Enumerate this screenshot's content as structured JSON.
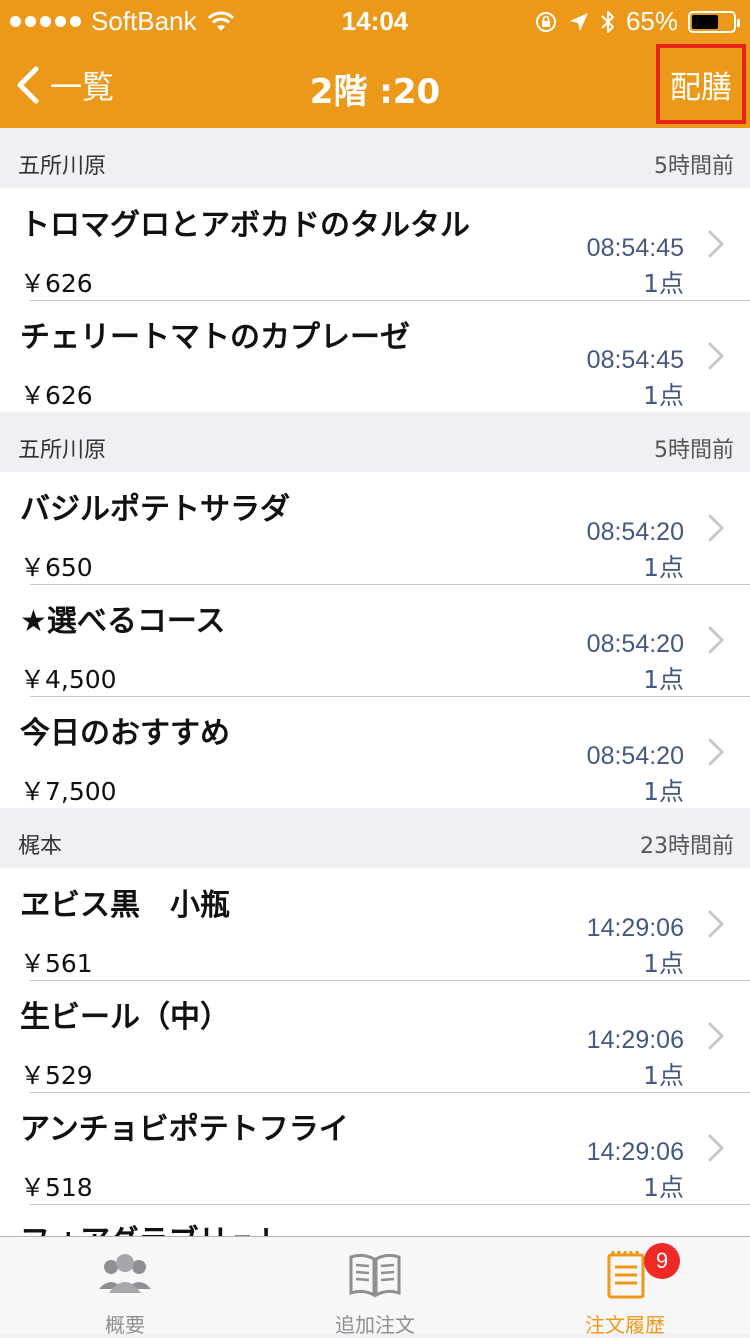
{
  "status_bar": {
    "carrier": "SoftBank",
    "time": "14:04",
    "battery_percent": "65%",
    "battery_level": 0.65
  },
  "nav": {
    "back_label": "一覧",
    "title": "2階 :20",
    "action_label": "配膳"
  },
  "sections": [
    {
      "name": "五所川原",
      "ago": "5時間前",
      "rows": [
        {
          "item": "トロマグロとアボカドのタルタル",
          "price": "￥626",
          "time": "08:54:45",
          "qty": "1点"
        },
        {
          "item": "チェリートマトのカプレーゼ",
          "price": "￥626",
          "time": "08:54:45",
          "qty": "1点"
        }
      ]
    },
    {
      "name": "五所川原",
      "ago": "5時間前",
      "rows": [
        {
          "item": "バジルポテトサラダ",
          "price": "￥650",
          "time": "08:54:20",
          "qty": "1点"
        },
        {
          "item": "★選べるコース",
          "price": "￥4,500",
          "time": "08:54:20",
          "qty": "1点"
        },
        {
          "item": "今日のおすすめ",
          "price": "￥7,500",
          "time": "08:54:20",
          "qty": "1点"
        }
      ]
    },
    {
      "name": "梶本",
      "ago": "23時間前",
      "rows": [
        {
          "item": "ヱビス黒　小瓶",
          "price": "￥561",
          "time": "14:29:06",
          "qty": "1点"
        },
        {
          "item": "生ビール（中）",
          "price": "￥529",
          "time": "14:29:06",
          "qty": "1点"
        },
        {
          "item": "アンチョビポテトフライ",
          "price": "￥518",
          "time": "14:29:06",
          "qty": "1点"
        },
        {
          "item": "フォアグラブリュレ",
          "price": "",
          "time": "",
          "qty": ""
        }
      ]
    }
  ],
  "tabs": [
    {
      "label": "概要",
      "icon": "people-icon"
    },
    {
      "label": "追加注文",
      "icon": "book-icon"
    },
    {
      "label": "注文履歴",
      "icon": "notepad-icon",
      "badge": "9",
      "active": true
    }
  ],
  "colors": {
    "accent": "#ec991a",
    "badge": "#ee2a24",
    "highlight_border": "#e8221a"
  }
}
